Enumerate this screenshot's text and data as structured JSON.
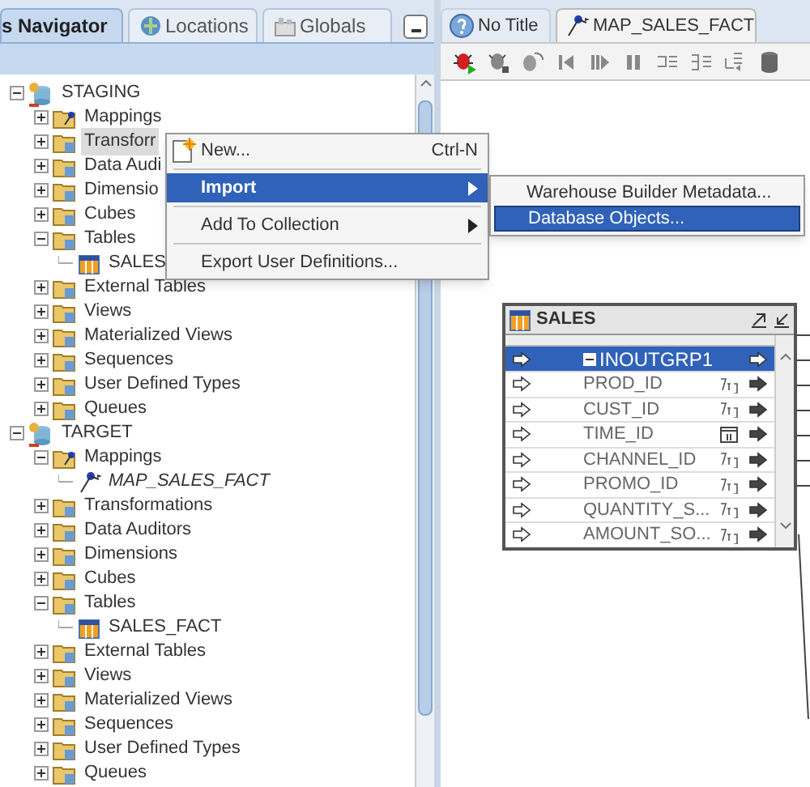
{
  "navigator": {
    "tabs": [
      {
        "label": "s Navigator",
        "selected": true
      },
      {
        "label": "Locations",
        "selected": false
      },
      {
        "label": "Globals",
        "selected": false
      }
    ],
    "tree": [
      {
        "label": "STAGING",
        "kind": "database",
        "expanded": true,
        "selected": false,
        "children": [
          {
            "label": "Mappings",
            "kind": "mapfolder",
            "expanded": false,
            "selected": false
          },
          {
            "label": "Transforr",
            "kind": "folder",
            "expanded": false,
            "selected": true
          },
          {
            "label": "Data Audi",
            "kind": "folder",
            "expanded": false,
            "selected": false
          },
          {
            "label": "Dimensio",
            "kind": "folder",
            "expanded": false,
            "selected": false
          },
          {
            "label": "Cubes",
            "kind": "folder",
            "expanded": false,
            "selected": false
          },
          {
            "label": "Tables",
            "kind": "folder",
            "expanded": true,
            "selected": false,
            "children": [
              {
                "label": "SALES",
                "kind": "table",
                "selected": false
              }
            ]
          },
          {
            "label": "External Tables",
            "kind": "folder",
            "expanded": false,
            "selected": false
          },
          {
            "label": "Views",
            "kind": "folder",
            "expanded": false,
            "selected": false
          },
          {
            "label": "Materialized Views",
            "kind": "folder",
            "expanded": false,
            "selected": false
          },
          {
            "label": "Sequences",
            "kind": "folder",
            "expanded": false,
            "selected": false
          },
          {
            "label": "User Defined Types",
            "kind": "folder",
            "expanded": false,
            "selected": false
          },
          {
            "label": "Queues",
            "kind": "folder",
            "expanded": false,
            "selected": false
          }
        ]
      },
      {
        "label": "TARGET",
        "kind": "database",
        "expanded": true,
        "selected": false,
        "children": [
          {
            "label": "Mappings",
            "kind": "mapfolder",
            "expanded": true,
            "selected": false,
            "children": [
              {
                "label": "MAP_SALES_FACT",
                "kind": "mapping",
                "selected": false
              }
            ]
          },
          {
            "label": "Transformations",
            "kind": "folder",
            "expanded": false,
            "selected": false
          },
          {
            "label": "Data Auditors",
            "kind": "folder",
            "expanded": false,
            "selected": false
          },
          {
            "label": "Dimensions",
            "kind": "folder",
            "expanded": false,
            "selected": false
          },
          {
            "label": "Cubes",
            "kind": "folder",
            "expanded": false,
            "selected": false
          },
          {
            "label": "Tables",
            "kind": "folder",
            "expanded": true,
            "selected": false,
            "children": [
              {
                "label": "SALES_FACT",
                "kind": "table",
                "selected": false
              }
            ]
          },
          {
            "label": "External Tables",
            "kind": "folder",
            "expanded": false,
            "selected": false
          },
          {
            "label": "Views",
            "kind": "folder",
            "expanded": false,
            "selected": false
          },
          {
            "label": "Materialized Views",
            "kind": "folder",
            "expanded": false,
            "selected": false
          },
          {
            "label": "Sequences",
            "kind": "folder",
            "expanded": false,
            "selected": false
          },
          {
            "label": "User Defined Types",
            "kind": "folder",
            "expanded": false,
            "selected": false
          },
          {
            "label": "Queues",
            "kind": "folder",
            "expanded": false,
            "selected": false
          }
        ]
      }
    ]
  },
  "editor": {
    "tabs": [
      {
        "label": "No Title",
        "selected": false
      },
      {
        "label": "MAP_SALES_FACT",
        "selected": true
      }
    ],
    "operator": {
      "title": "SALES",
      "group": {
        "label": "INOUTGRP1",
        "selected": true
      },
      "attributes": [
        {
          "name": "PROD_ID",
          "kind": "text"
        },
        {
          "name": "CUST_ID",
          "kind": "text"
        },
        {
          "name": "TIME_ID",
          "kind": "date"
        },
        {
          "name": "CHANNEL_ID",
          "kind": "text"
        },
        {
          "name": "PROMO_ID",
          "kind": "text"
        },
        {
          "name": "QUANTITY_S...",
          "kind": "text"
        },
        {
          "name": "AMOUNT_SO...",
          "kind": "text"
        }
      ]
    }
  },
  "context_menu": {
    "items": [
      {
        "label": "New...",
        "shortcut": "Ctrl-N",
        "selected": false,
        "has_submenu": false
      },
      {
        "label": "Import",
        "selected": true,
        "has_submenu": true
      },
      {
        "label": "Add To Collection",
        "selected": false,
        "has_submenu": true
      },
      {
        "label": "Export User Definitions...",
        "selected": false,
        "has_submenu": false
      }
    ],
    "submenu": [
      {
        "label": "Warehouse Builder Metadata...",
        "selected": false
      },
      {
        "label": "Database Objects...",
        "selected": true
      }
    ]
  }
}
